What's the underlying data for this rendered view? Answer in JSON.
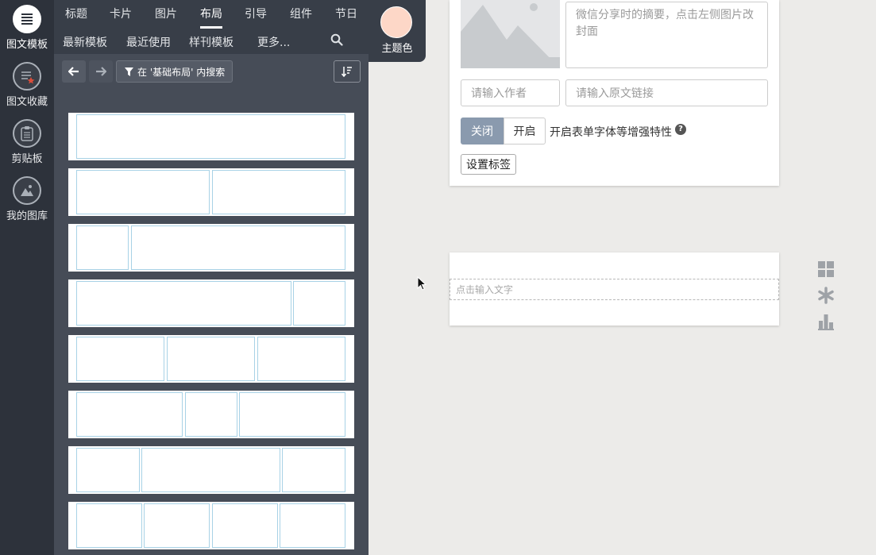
{
  "rail": {
    "items": [
      {
        "label": "图文模板",
        "icon": "template-list-icon"
      },
      {
        "label": "图文收藏",
        "icon": "favorites-icon"
      },
      {
        "label": "剪贴板",
        "icon": "clipboard-icon"
      },
      {
        "label": "我的图库",
        "icon": "gallery-icon"
      }
    ]
  },
  "tabs": [
    "标题",
    "卡片",
    "图片",
    "布局",
    "引导",
    "组件",
    "节日"
  ],
  "active_tab": "布局",
  "subtabs": [
    "最新模板",
    "最近使用",
    "样刊模板",
    "更多..."
  ],
  "theme": {
    "label": "主题色",
    "color": "#fdd7c7"
  },
  "toolbar": {
    "filter_label": "在 '基础布局' 内搜索"
  },
  "layouts": [
    {
      "name": "one-column"
    },
    {
      "name": "two-equal"
    },
    {
      "name": "narrow-wide"
    },
    {
      "name": "wide-narrow"
    },
    {
      "name": "three-equal"
    },
    {
      "name": "mid-narrow-three"
    },
    {
      "name": "mid-wide-three"
    },
    {
      "name": "four-equal"
    }
  ],
  "editor": {
    "summary_placeholder": "微信分享时的摘要，点击左侧图片改封面",
    "author_placeholder": "请输入作者",
    "link_placeholder": "请输入原文链接",
    "toggle_off": "关闭",
    "toggle_on": "开启",
    "enhance_label": "开启表单字体等增强特性",
    "tag_button": "设置标签",
    "text_placeholder": "点击输入文字"
  },
  "colors": {
    "rail_bg": "#2d323b",
    "panel_bg": "#464c57",
    "cell_border": "#a8d2e6",
    "toggle_active": "#8a9aae"
  }
}
